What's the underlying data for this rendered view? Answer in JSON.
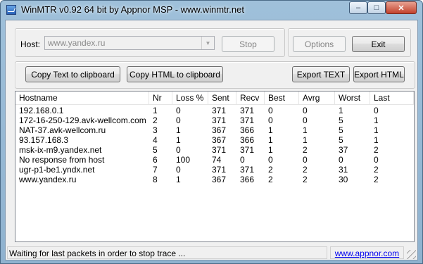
{
  "window": {
    "title": "WinMTR v0.92 64 bit by Appnor MSP - www.winmtr.net",
    "controls": {
      "minimize": "–",
      "maximize": "□",
      "close": "✕"
    }
  },
  "host": {
    "label": "Host:",
    "value": "www.yandex.ru"
  },
  "buttons": {
    "stop": "Stop",
    "options": "Options",
    "exit": "Exit",
    "copy_text": "Copy Text to clipboard",
    "copy_html": "Copy HTML to clipboard",
    "export_text": "Export TEXT",
    "export_html": "Export HTML"
  },
  "table": {
    "columns": [
      "Hostname",
      "Nr",
      "Loss %",
      "Sent",
      "Recv",
      "Best",
      "Avrg",
      "Worst",
      "Last"
    ],
    "rows": [
      [
        "192.168.0.1",
        "1",
        "0",
        "371",
        "371",
        "0",
        "0",
        "1",
        "0"
      ],
      [
        "172-16-250-129.avk-wellcom.com",
        "2",
        "0",
        "371",
        "371",
        "0",
        "0",
        "5",
        "1"
      ],
      [
        "NAT-37.avk-wellcom.ru",
        "3",
        "1",
        "367",
        "366",
        "1",
        "1",
        "5",
        "1"
      ],
      [
        "93.157.168.3",
        "4",
        "1",
        "367",
        "366",
        "1",
        "1",
        "5",
        "1"
      ],
      [
        "msk-ix-m9.yandex.net",
        "5",
        "0",
        "371",
        "371",
        "1",
        "2",
        "37",
        "2"
      ],
      [
        "No response from host",
        "6",
        "100",
        "74",
        "0",
        "0",
        "0",
        "0",
        "0"
      ],
      [
        "ugr-p1-be1.yndx.net",
        "7",
        "0",
        "371",
        "371",
        "2",
        "2",
        "31",
        "2"
      ],
      [
        "www.yandex.ru",
        "8",
        "1",
        "367",
        "366",
        "2",
        "2",
        "30",
        "2"
      ]
    ]
  },
  "status": {
    "text": "Waiting for last packets in order to stop trace ...",
    "link": "www.appnor.com"
  },
  "colors": {
    "titlebar": "#9fc0da",
    "link": "#0000ee",
    "close_button": "#c2412c"
  }
}
